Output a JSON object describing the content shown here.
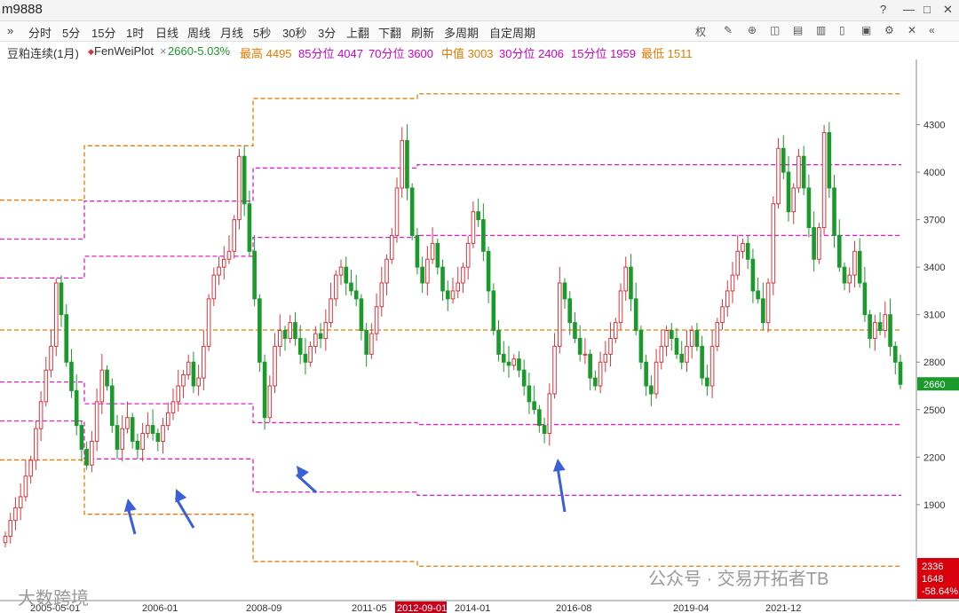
{
  "window": {
    "title": "m9888"
  },
  "win_controls": [
    "?",
    "—",
    "□",
    "✕"
  ],
  "toolbar": {
    "collapse": "»",
    "periods": [
      "分时",
      "5分",
      "15分",
      "1时",
      "日线",
      "周线",
      "月线",
      "5秒",
      "30秒",
      "3分",
      "上翻",
      "下翻",
      "刷新",
      "多周期",
      "自定周期"
    ],
    "right_icons": [
      "权",
      "pen-icon",
      "download-icon",
      "layers-icon",
      "grid-icon",
      "copy-icon",
      "delete-icon",
      "layout-icon",
      "settings-icon",
      "close-icon",
      "more-icon"
    ],
    "right_icon_glyphs": [
      "权",
      "✎",
      "⊕",
      "◫",
      "▤",
      "▥",
      "▯",
      "▣",
      "⚙",
      "✕",
      "«"
    ]
  },
  "legend": {
    "symbol": "豆粕连续(1月)",
    "indicator": "FenWeiPlot",
    "close_change": "2660-5.03%",
    "items": [
      {
        "label": "最高 4495",
        "color": "#e87a00"
      },
      {
        "label": "85分位 4047",
        "color": "#cc00cc"
      },
      {
        "label": "70分位 3600",
        "color": "#cc00cc"
      },
      {
        "label": "中值 3003",
        "color": "#e87a00"
      },
      {
        "label": "30分位 2406",
        "color": "#cc00cc"
      },
      {
        "label": "15分位 1959",
        "color": "#cc00cc"
      },
      {
        "label": "最低 1511",
        "color": "#e87a00"
      }
    ]
  },
  "y_axis": {
    "ticks": [
      "4300",
      "4000",
      "3700",
      "3400",
      "3100",
      "2800",
      "2500",
      "2200",
      "1900"
    ],
    "current_price": "2660",
    "current_color": "#1a9a2a",
    "bottom_box": [
      "2336",
      "1648",
      "-58.64%"
    ]
  },
  "x_axis": {
    "labels": [
      "2005-05-01",
      "2006-01",
      "2008-09",
      "2011-05",
      "2012-09-01",
      "2014-01",
      "2016-08",
      "2019-04",
      "2021-12"
    ]
  },
  "watermarks": {
    "left": "大数跨境",
    "right": "公众号 · 交易开拓者TB"
  },
  "colors": {
    "up": "#d9363e",
    "down": "#1a9a2a",
    "orange_line": "#e87a00",
    "magenta_line": "#e020c8",
    "arrow": "#3a5fd8"
  },
  "chart_data": {
    "type": "candlestick",
    "symbol": "豆粕连续(1月)",
    "period": "月线",
    "ylim": [
      1511,
      4495
    ],
    "levels": [
      {
        "name": "最高",
        "value": 4495
      },
      {
        "name": "85分位",
        "value": 4047
      },
      {
        "name": "70分位",
        "value": 3600
      },
      {
        "name": "中值",
        "value": 3003
      },
      {
        "name": "30分位",
        "value": 2406
      },
      {
        "name": "15分位",
        "value": 1959
      },
      {
        "name": "最低",
        "value": 1511
      }
    ],
    "last_close": 2660,
    "last_change_pct": -5.03,
    "closes": [
      1700,
      1800,
      1880,
      1950,
      2080,
      2180,
      2380,
      2550,
      2750,
      2900,
      3300,
      3100,
      2800,
      2620,
      2400,
      2250,
      2150,
      2300,
      2550,
      2750,
      2650,
      2400,
      2250,
      2380,
      2450,
      2300,
      2250,
      2350,
      2400,
      2350,
      2300,
      2400,
      2480,
      2550,
      2650,
      2720,
      2800,
      2650,
      2700,
      2900,
      3200,
      3350,
      3400,
      3450,
      3500,
      3700,
      4100,
      3800,
      3500,
      3200,
      2800,
      2450,
      2650,
      2900,
      3000,
      2950,
      3050,
      2950,
      2850,
      2800,
      2900,
      2980,
      2950,
      3050,
      3200,
      3350,
      3400,
      3300,
      3250,
      3200,
      3000,
      2850,
      2980,
      3150,
      3300,
      3450,
      3600,
      3900,
      4200,
      3900,
      3600,
      3400,
      3300,
      3450,
      3550,
      3400,
      3250,
      3200,
      3250,
      3300,
      3400,
      3550,
      3750,
      3700,
      3500,
      3250,
      3000,
      2850,
      2800,
      2780,
      2820,
      2750,
      2650,
      2550,
      2500,
      2400,
      2350,
      2600,
      2900,
      3300,
      3200,
      3050,
      2950,
      2850,
      2850,
      2700,
      2650,
      2800,
      2850,
      2950,
      3050,
      3250,
      3400,
      3200,
      3000,
      2800,
      2650,
      2600,
      2800,
      2900,
      3000,
      2950,
      2850,
      2800,
      2900,
      3000,
      2900,
      2700,
      2650,
      2900,
      3050,
      3150,
      3250,
      3350,
      3500,
      3550,
      3450,
      3250,
      3200,
      3050,
      3300,
      3800,
      4150,
      4000,
      3750,
      3900,
      4100,
      3900,
      3650,
      3450,
      3650,
      4250,
      3900,
      3600,
      3400,
      3300,
      3350,
      3500,
      3300,
      3100,
      2950,
      3050,
      3000,
      3100,
      2900,
      2800,
      2660
    ]
  }
}
